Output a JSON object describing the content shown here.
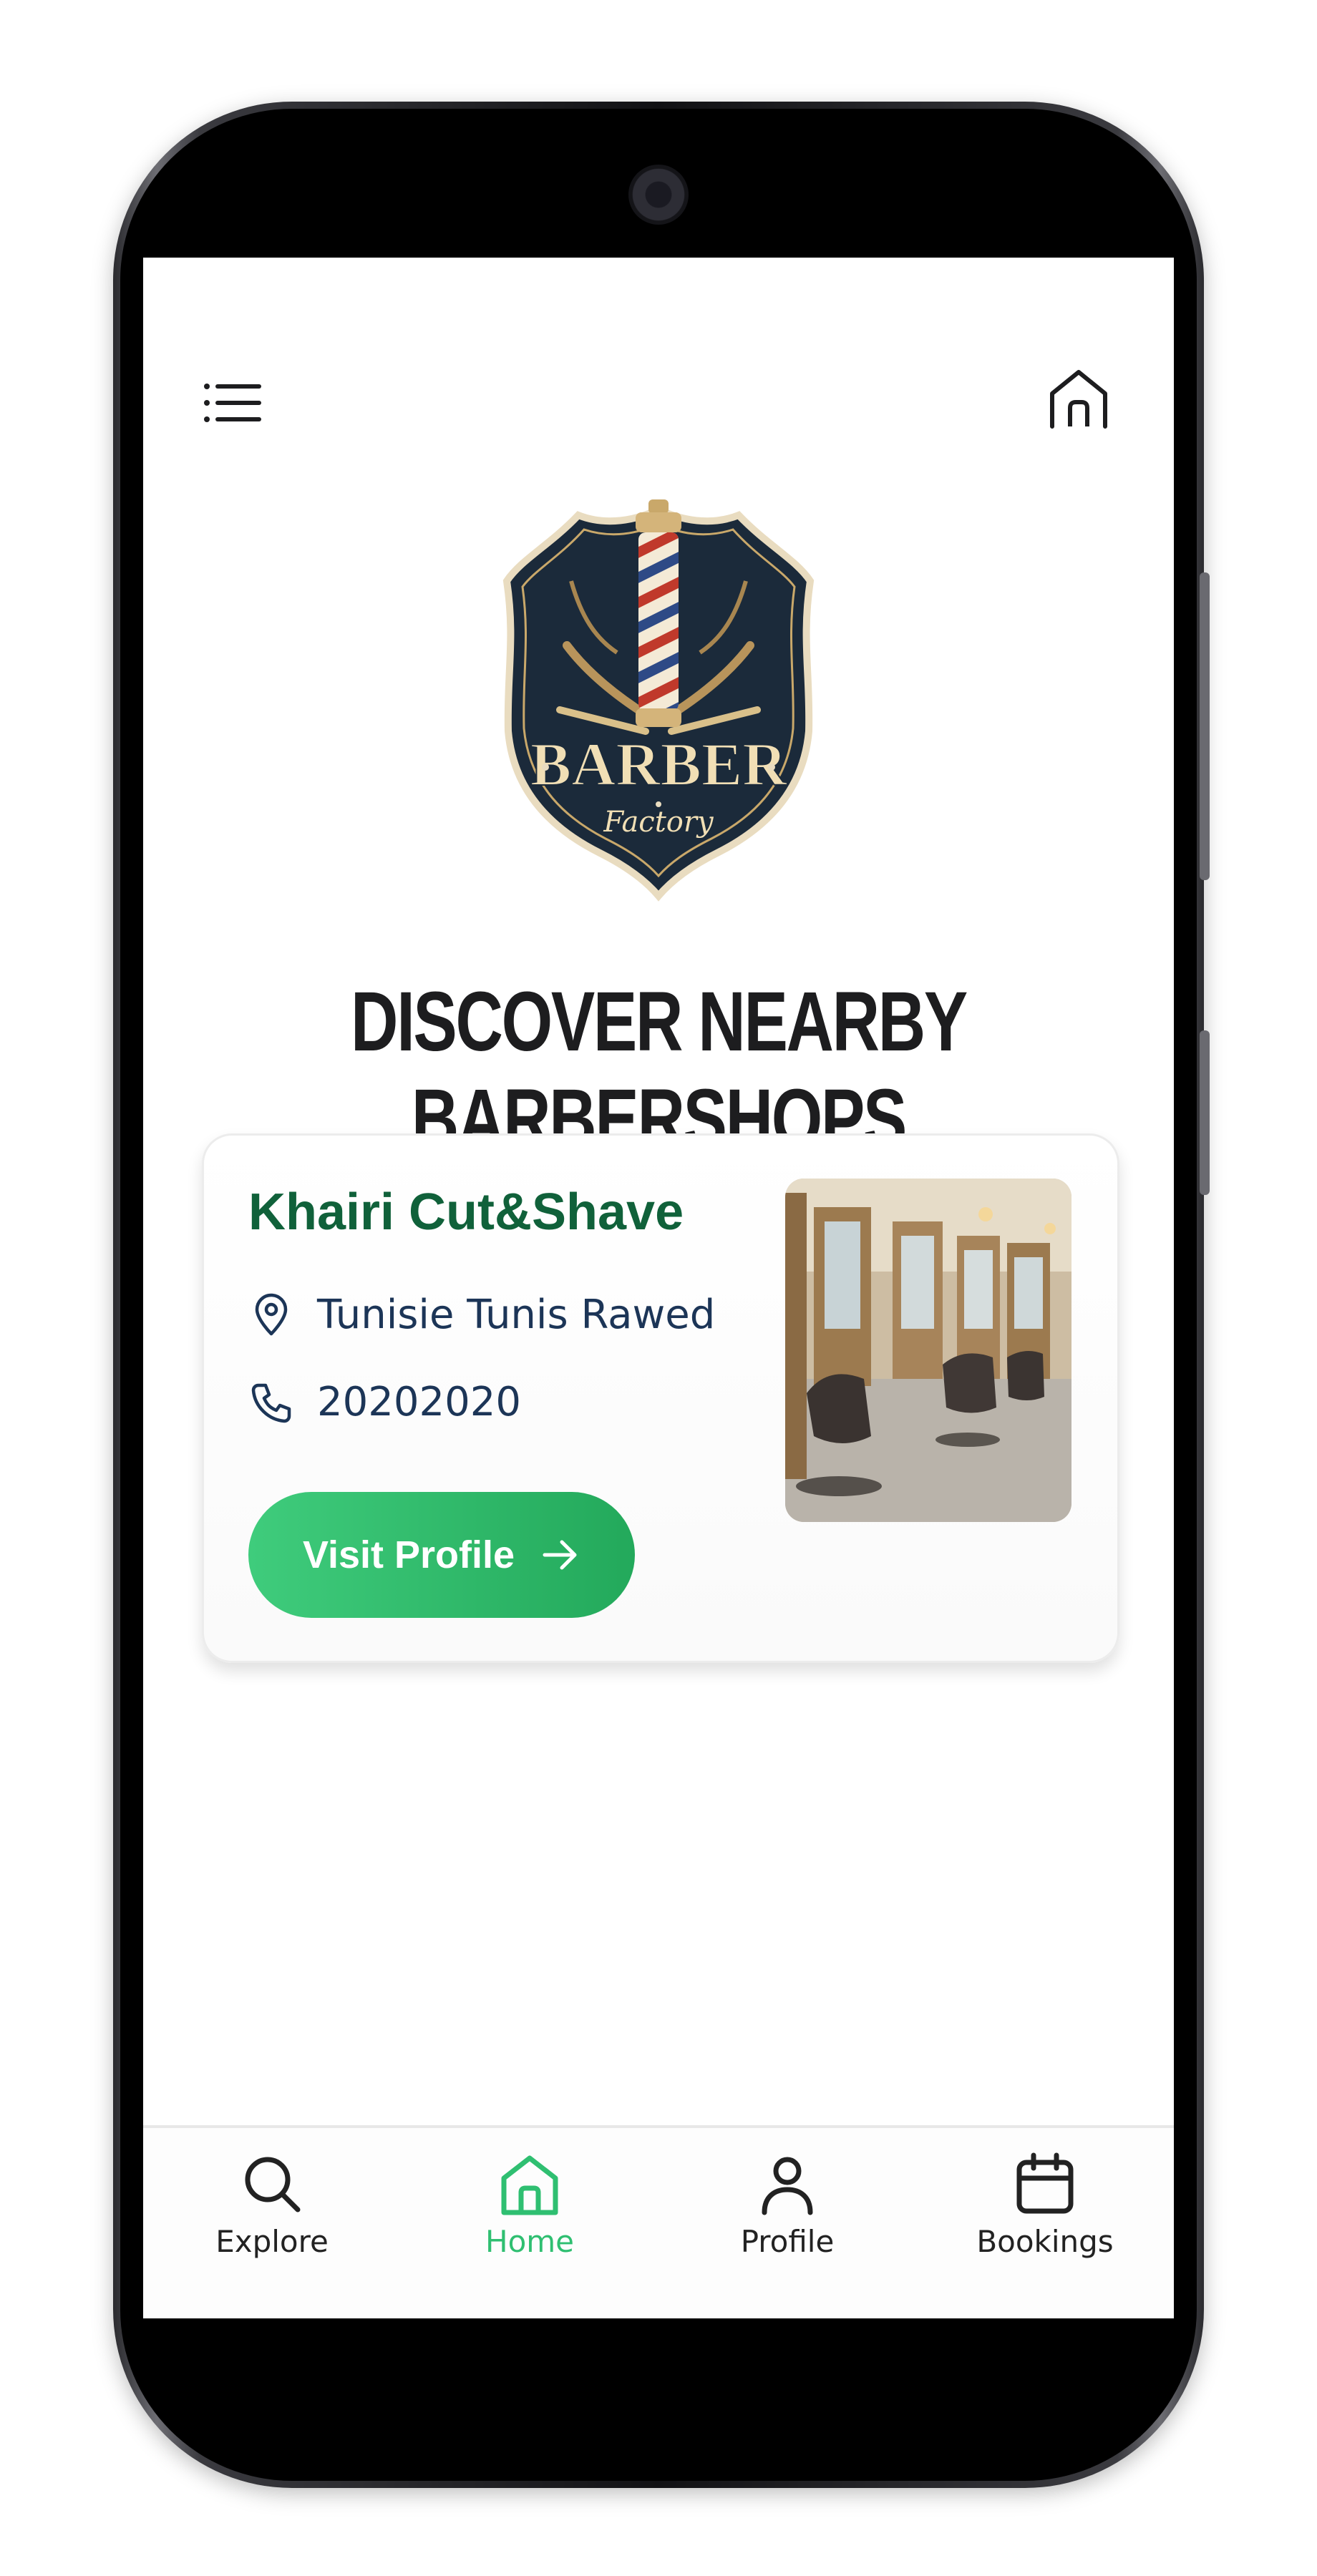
{
  "header": {
    "menu_icon": "menu-list-icon",
    "home_icon": "home-icon"
  },
  "logo": {
    "text_main": "BARBER",
    "text_script": "Factory"
  },
  "page_title": "DISCOVER NEARBY BARBERSHOPS",
  "shop_card": {
    "name": "Khairi Cut&Shave",
    "address": "Tunisie Tunis Rawed",
    "phone": "20202020",
    "button_label": "Visit Profile",
    "address_icon": "location-pin-icon",
    "phone_icon": "phone-icon",
    "button_icon": "arrow-right-icon"
  },
  "bottom_nav": {
    "items": [
      {
        "label": "Explore",
        "icon": "search-icon",
        "active": false
      },
      {
        "label": "Home",
        "icon": "home-icon",
        "active": true
      },
      {
        "label": "Profile",
        "icon": "user-icon",
        "active": false
      },
      {
        "label": "Bookings",
        "icon": "calendar-icon",
        "active": false
      }
    ]
  },
  "colors": {
    "accent_green": "#2fbf71",
    "shop_name_green": "#10613a",
    "text_navy": "#1c3557",
    "logo_navy": "#1b2a3a",
    "logo_cream": "#f1dfb5"
  }
}
